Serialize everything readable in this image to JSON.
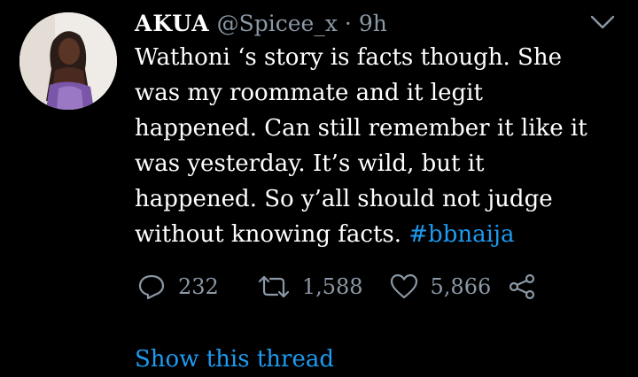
{
  "tweet": {
    "author_name": "AKUA",
    "handle": "@Spicee_x",
    "separator": "·",
    "time": "9h",
    "text_lines": [
      "Wathoni ‘s story is facts though. She",
      "was my roommate and it legit",
      "happened. Can still remember it like it",
      "was yesterday. It’s wild, but it",
      "happened. So y’all should not judge",
      "without knowing facts."
    ],
    "hashtag": "#bbnaija",
    "stats": {
      "replies": "232",
      "retweets": "1,588",
      "likes": "5,866"
    },
    "show_thread_label": "Show this thread"
  },
  "colors": {
    "background": "#000000",
    "text": "#ffffff",
    "muted": "#8b98a5",
    "accent": "#1d9bf0"
  },
  "icons": {
    "more": "chevron-down-icon",
    "reply": "reply-icon",
    "retweet": "retweet-icon",
    "like": "heart-icon",
    "share": "share-icon"
  }
}
